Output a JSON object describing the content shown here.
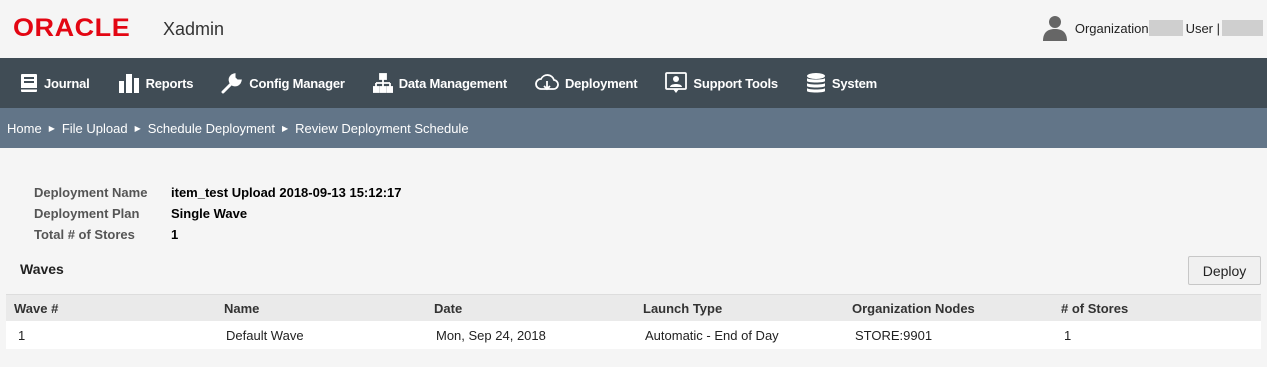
{
  "header": {
    "logo": "ORACLE",
    "app_name": "Xadmin",
    "org_label": "Organization",
    "user_label": "User |"
  },
  "nav": {
    "items": [
      {
        "label": "Journal",
        "icon": "journal-icon"
      },
      {
        "label": "Reports",
        "icon": "reports-icon"
      },
      {
        "label": "Config Manager",
        "icon": "wrench-icon"
      },
      {
        "label": "Data Management",
        "icon": "hierarchy-icon"
      },
      {
        "label": "Deployment",
        "icon": "cloud-download-icon"
      },
      {
        "label": "Support Tools",
        "icon": "support-icon"
      },
      {
        "label": "System",
        "icon": "database-icon"
      }
    ]
  },
  "breadcrumb": [
    "Home",
    "File Upload",
    "Schedule Deployment",
    "Review Deployment Schedule"
  ],
  "details": {
    "deployment_name_label": "Deployment Name",
    "deployment_name": "item_test Upload 2018-09-13 15:12:17",
    "deployment_plan_label": "Deployment Plan",
    "deployment_plan": "Single Wave",
    "total_stores_label": "Total # of Stores",
    "total_stores": "1"
  },
  "waves": {
    "title": "Waves",
    "deploy_label": "Deploy",
    "columns": [
      "Wave #",
      "Name",
      "Date",
      "Launch Type",
      "Organization Nodes",
      "# of Stores"
    ],
    "rows": [
      [
        "1",
        "Default Wave",
        "Mon, Sep 24, 2018",
        "Automatic - End of Day",
        "STORE:9901",
        "1"
      ]
    ]
  },
  "colors": {
    "brand_red": "#e30613",
    "navbar_bg": "#404c55",
    "breadcrumb_bg": "#627588"
  }
}
